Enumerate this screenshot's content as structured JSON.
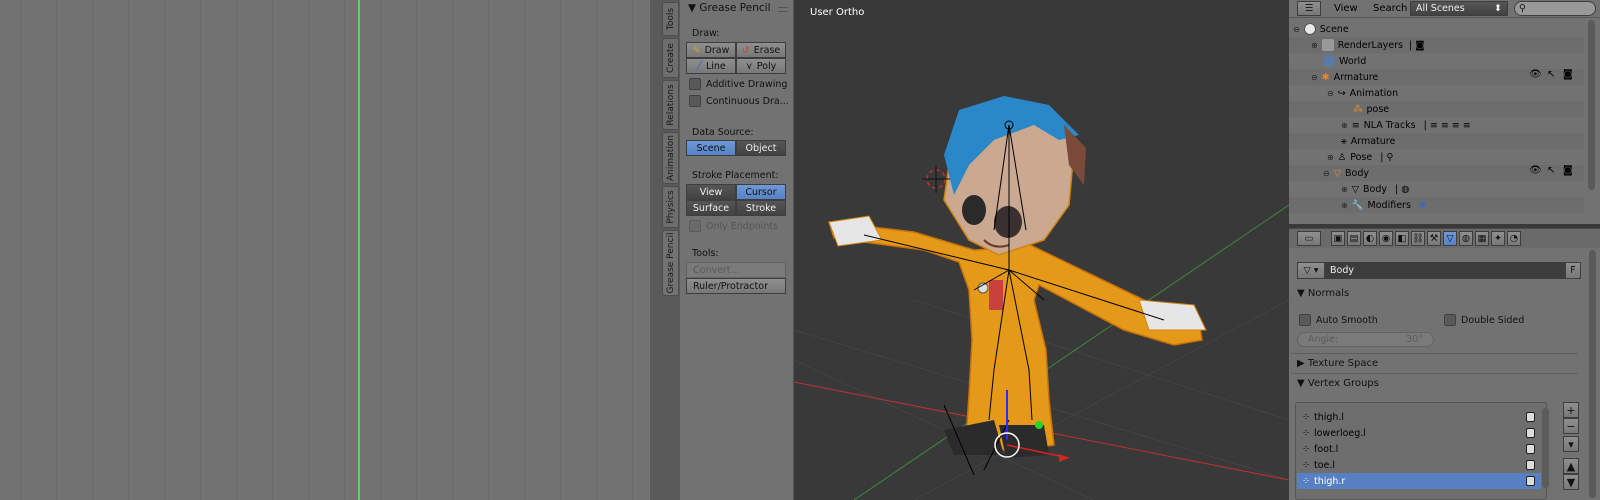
{
  "tool_shelf": {
    "panel_title": "Grease Pencil",
    "draw_label": "Draw:",
    "draw_button": "Draw",
    "erase_button": "Erase",
    "line_button": "Line",
    "poly_button": "Poly",
    "additive_drawing": "Additive Drawing",
    "continuous_drawing": "Continuous Dra...",
    "data_source_label": "Data Source:",
    "scene_button": "Scene",
    "object_button": "Object",
    "stroke_placement_label": "Stroke Placement:",
    "view_button": "View",
    "cursor_button": "Cursor",
    "surface_button": "Surface",
    "stroke_button": "Stroke",
    "only_endpoints": "Only Endpoints",
    "tools_label": "Tools:",
    "convert_button": "Convert...",
    "ruler_button": "Ruler/Protractor"
  },
  "tabs": [
    "Tools",
    "Create",
    "Relations",
    "Animation",
    "Physics",
    "Grease Pencil"
  ],
  "viewport": {
    "label": "User Ortho"
  },
  "outliner_header": {
    "view_menu": "View",
    "search_menu": "Search",
    "display_mode": "All Scenes"
  },
  "outliner": {
    "scene": "Scene",
    "render_layers": "RenderLayers",
    "world": "World",
    "armature": "Armature",
    "animation": "Animation",
    "pose_action": "pose",
    "nla_tracks": "NLA Tracks",
    "armature_data": "Armature",
    "pose": "Pose",
    "body": "Body",
    "body_mesh": "Body",
    "modifiers": "Modifiers"
  },
  "properties": {
    "object_name": "Body",
    "fake_user": "F",
    "normals_title": "Normals",
    "auto_smooth": "Auto Smooth",
    "double_sided": "Double Sided",
    "angle_label": "Angle:",
    "angle_value": "30°",
    "texture_space_title": "Texture Space",
    "vertex_groups_title": "Vertex Groups",
    "vertex_groups": [
      "thigh.l",
      "lowerloeg.l",
      "foot.l",
      "toe.l",
      "thigh.r"
    ],
    "selected_group": "thigh.r"
  },
  "colors": {
    "accent": "#5680c2",
    "timeline_cursor": "#5fd35a",
    "suit": "#e59a1a",
    "hair": "#2a88c8"
  }
}
